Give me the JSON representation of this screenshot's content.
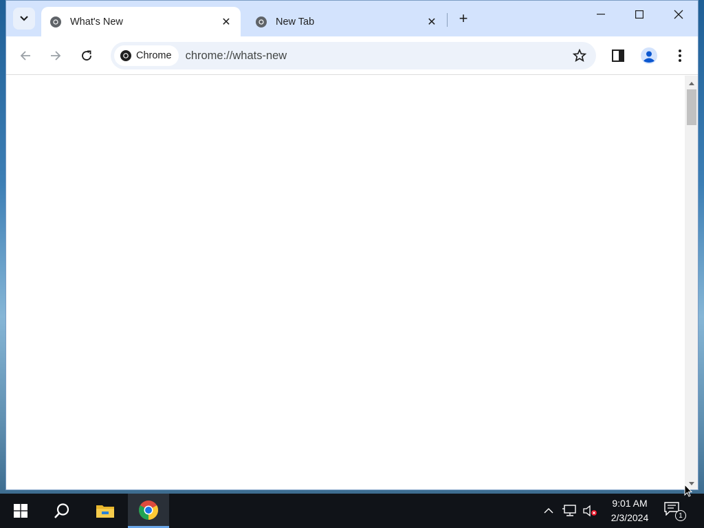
{
  "browser": {
    "tabs": [
      {
        "title": "What's New",
        "active": true,
        "close_label": "✕"
      },
      {
        "title": "New Tab",
        "active": false,
        "close_label": "✕"
      }
    ],
    "new_tab_label": "+",
    "site_chip_label": "Chrome",
    "url": "chrome://whats-new",
    "colors": {
      "tabstrip": "#d3e3fd",
      "omnibox": "#edf2fa",
      "profile_accent": "#0b57d0"
    }
  },
  "taskbar": {
    "clock_time": "9:01 AM",
    "clock_date": "2/3/2024",
    "notification_count": "1",
    "pinned_icons": [
      "windows-start-icon",
      "search-icon",
      "file-explorer-icon",
      "chrome-icon"
    ]
  }
}
